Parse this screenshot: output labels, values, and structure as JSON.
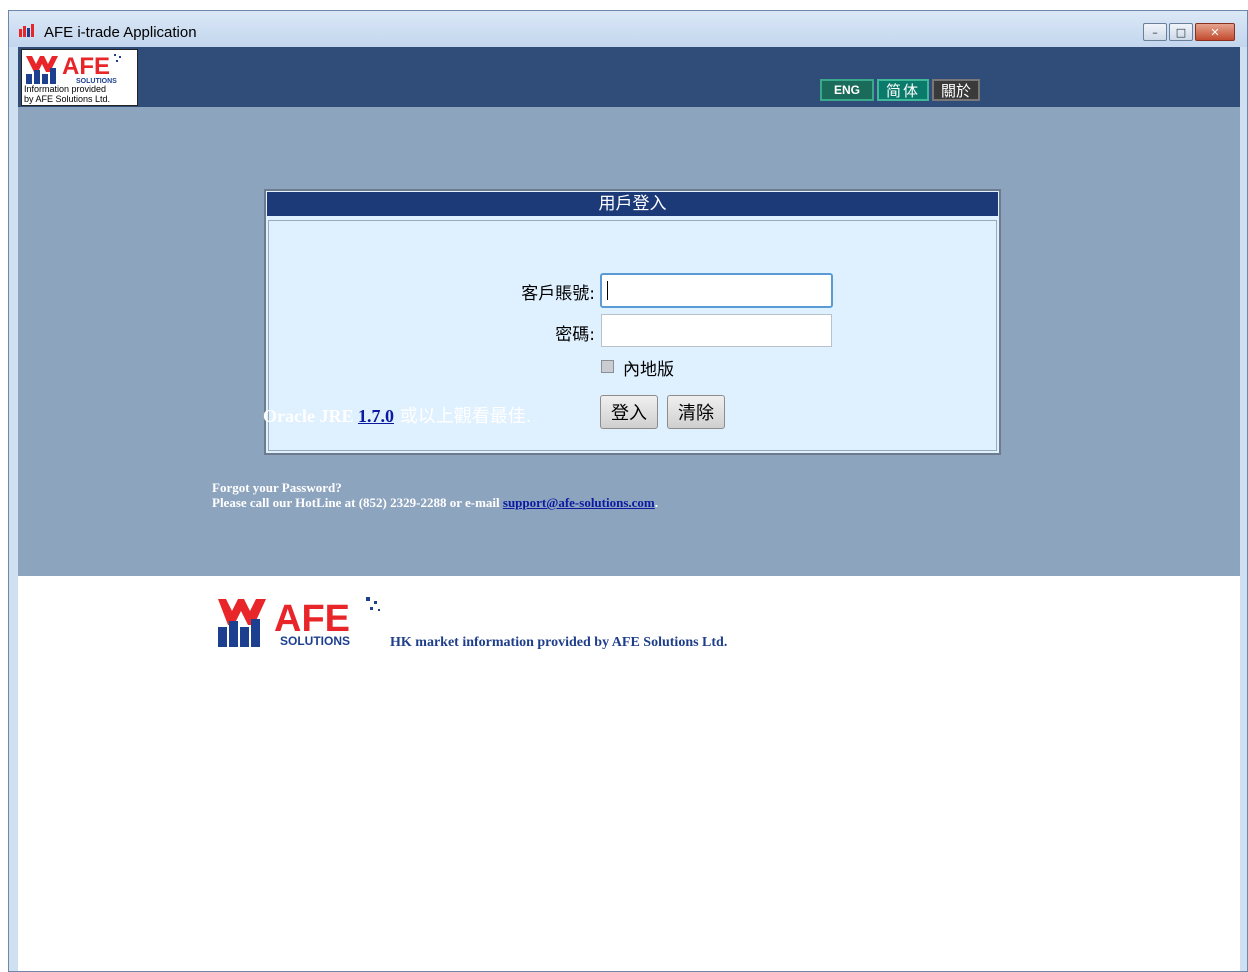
{
  "window": {
    "title": "AFE i-trade Application",
    "controls": {
      "minimize": "–",
      "maximize": "□",
      "close": "✕"
    }
  },
  "header": {
    "logo_text": "AFE",
    "logo_sub": "SOLUTIONS",
    "logo_caption_line1": "Information provided",
    "logo_caption_line2": "by AFE Solutions Ltd.",
    "lang_eng": "ENG",
    "lang_simplified": "简体",
    "about": "關於"
  },
  "login": {
    "title": "用戶登入",
    "account_label": "客戶賬號:",
    "account_value": "",
    "password_label": "密碼:",
    "password_value": "",
    "mainland_label": "內地版",
    "mainland_checked": false,
    "login_button": "登入",
    "clear_button": "清除"
  },
  "jre": {
    "prefix": "Oracle JRE ",
    "version": "1.7.0",
    "suffix": " 或以上觀看最佳."
  },
  "forgot": {
    "line1": "Forgot your Password?",
    "line2": "Please call our HotLine at (852) 2329-2288 or e-mail ",
    "email": "support@afe-solutions.com",
    "period": "."
  },
  "footer": {
    "logo_text": "AFE",
    "logo_sub": "SOLUTIONS",
    "text": "HK market information provided by AFE Solutions Ltd."
  },
  "colors": {
    "header_bg": "#2f4d78",
    "body_bg": "#8da4bf",
    "panel_bg": "#dff0ff",
    "panel_title_bg": "#1c3a78",
    "logo_red": "#e8262a",
    "logo_blue": "#1d3f8f"
  }
}
